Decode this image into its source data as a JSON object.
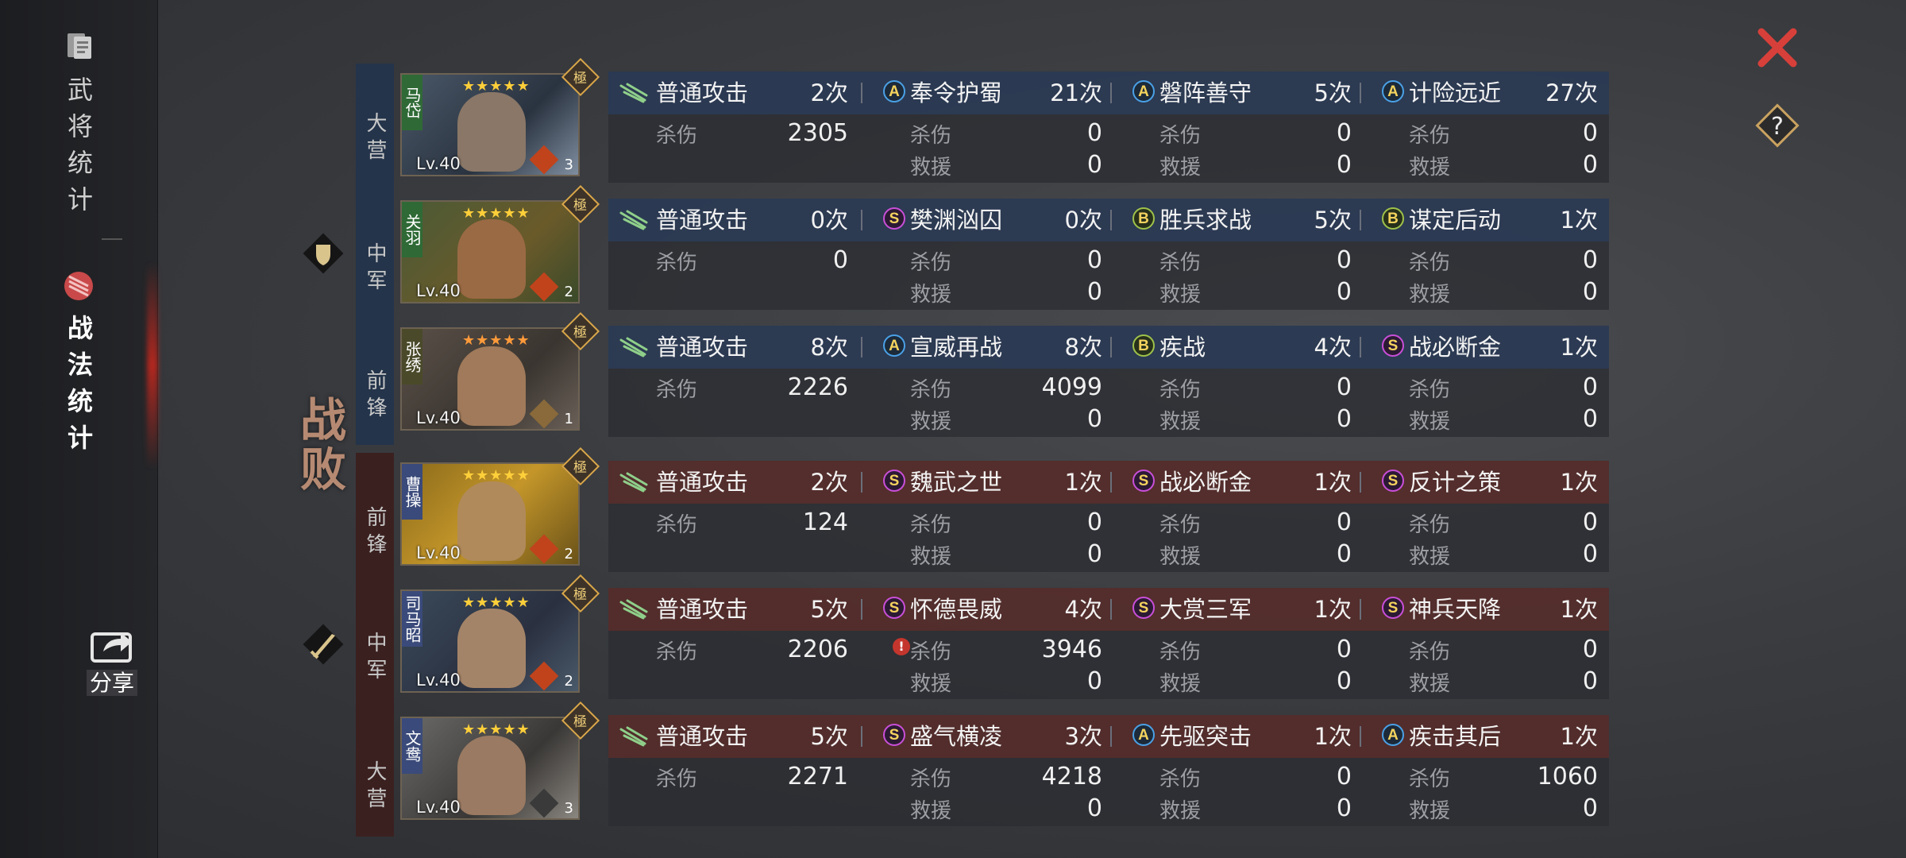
{
  "sidebar": {
    "stats_label": "武将统计",
    "tactic_label": "战法统计",
    "share_label": "分享"
  },
  "result_label": "战败",
  "header_buttons": {
    "close": "close",
    "help": "?"
  },
  "teams": [
    {
      "side": "ally",
      "color": "#24344a",
      "generals": [
        {
          "position": "大营",
          "name": "马岱",
          "level": "Lv.40",
          "stars": 5,
          "rank": "極",
          "copies": "3",
          "skills": [
            {
              "grade": "",
              "name": "普通攻击",
              "count": "2次",
              "kill_label": "杀伤",
              "kill": "2305",
              "heal_label": "",
              "heal": ""
            },
            {
              "grade": "A",
              "name": "奉令护蜀",
              "count": "21次",
              "kill_label": "杀伤",
              "kill": "0",
              "heal_label": "救援",
              "heal": "0"
            },
            {
              "grade": "A",
              "name": "磐阵善守",
              "count": "5次",
              "kill_label": "杀伤",
              "kill": "0",
              "heal_label": "救援",
              "heal": "0"
            },
            {
              "grade": "A",
              "name": "计险远近",
              "count": "27次",
              "kill_label": "杀伤",
              "kill": "0",
              "heal_label": "救援",
              "heal": "0"
            }
          ]
        },
        {
          "position": "中军",
          "name": "关羽",
          "level": "Lv.40",
          "stars": 5,
          "rank": "極",
          "copies": "2",
          "skills": [
            {
              "grade": "",
              "name": "普通攻击",
              "count": "0次",
              "kill_label": "杀伤",
              "kill": "0",
              "heal_label": "",
              "heal": ""
            },
            {
              "grade": "S",
              "name": "樊渊汹囚",
              "count": "0次",
              "kill_label": "杀伤",
              "kill": "0",
              "heal_label": "救援",
              "heal": "0"
            },
            {
              "grade": "B",
              "name": "胜兵求战",
              "count": "5次",
              "kill_label": "杀伤",
              "kill": "0",
              "heal_label": "救援",
              "heal": "0"
            },
            {
              "grade": "B",
              "name": "谋定后动",
              "count": "1次",
              "kill_label": "杀伤",
              "kill": "0",
              "heal_label": "救援",
              "heal": "0"
            }
          ]
        },
        {
          "position": "前锋",
          "name": "张绣",
          "level": "Lv.40",
          "stars": 5,
          "rank": "極",
          "copies": "1",
          "skills": [
            {
              "grade": "",
              "name": "普通攻击",
              "count": "8次",
              "kill_label": "杀伤",
              "kill": "2226",
              "heal_label": "",
              "heal": ""
            },
            {
              "grade": "A",
              "name": "宣威再战",
              "count": "8次",
              "kill_label": "杀伤",
              "kill": "4099",
              "heal_label": "救援",
              "heal": "0"
            },
            {
              "grade": "B",
              "name": "疾战",
              "count": "4次",
              "kill_label": "杀伤",
              "kill": "0",
              "heal_label": "救援",
              "heal": "0"
            },
            {
              "grade": "S",
              "name": "战必断金",
              "count": "1次",
              "kill_label": "杀伤",
              "kill": "0",
              "heal_label": "救援",
              "heal": "0"
            }
          ]
        }
      ]
    },
    {
      "side": "enemy",
      "color": "#3b2020",
      "generals": [
        {
          "position": "前锋",
          "name": "曹操",
          "level": "Lv.40",
          "stars": 5,
          "rank": "極",
          "copies": "2",
          "skills": [
            {
              "grade": "",
              "name": "普通攻击",
              "count": "2次",
              "kill_label": "杀伤",
              "kill": "124",
              "heal_label": "",
              "heal": ""
            },
            {
              "grade": "S",
              "name": "魏武之世",
              "count": "1次",
              "kill_label": "杀伤",
              "kill": "0",
              "heal_label": "救援",
              "heal": "0"
            },
            {
              "grade": "S",
              "name": "战必断金",
              "count": "1次",
              "kill_label": "杀伤",
              "kill": "0",
              "heal_label": "救援",
              "heal": "0"
            },
            {
              "grade": "S",
              "name": "反计之策",
              "count": "1次",
              "kill_label": "杀伤",
              "kill": "0",
              "heal_label": "救援",
              "heal": "0"
            }
          ]
        },
        {
          "position": "中军",
          "name": "司马昭",
          "level": "Lv.40",
          "stars": 5,
          "rank": "極",
          "copies": "2",
          "skills": [
            {
              "grade": "",
              "name": "普通攻击",
              "count": "5次",
              "kill_label": "杀伤",
              "kill": "2206",
              "heal_label": "",
              "heal": ""
            },
            {
              "grade": "S",
              "name": "怀德畏威",
              "count": "4次",
              "kill_label": "杀伤",
              "kill": "3946",
              "heal_label": "救援",
              "heal": "0",
              "warn": "!"
            },
            {
              "grade": "S",
              "name": "大赏三军",
              "count": "1次",
              "kill_label": "杀伤",
              "kill": "0",
              "heal_label": "救援",
              "heal": "0"
            },
            {
              "grade": "S",
              "name": "神兵天降",
              "count": "1次",
              "kill_label": "杀伤",
              "kill": "0",
              "heal_label": "救援",
              "heal": "0"
            }
          ]
        },
        {
          "position": "大营",
          "name": "文鸯",
          "level": "Lv.40",
          "stars": 5,
          "rank": "極",
          "copies": "3",
          "skills": [
            {
              "grade": "",
              "name": "普通攻击",
              "count": "5次",
              "kill_label": "杀伤",
              "kill": "2271",
              "heal_label": "",
              "heal": ""
            },
            {
              "grade": "S",
              "name": "盛气横凌",
              "count": "3次",
              "kill_label": "杀伤",
              "kill": "4218",
              "heal_label": "救援",
              "heal": "0"
            },
            {
              "grade": "A",
              "name": "先驱突击",
              "count": "1次",
              "kill_label": "杀伤",
              "kill": "0",
              "heal_label": "救援",
              "heal": "0"
            },
            {
              "grade": "A",
              "name": "疾击其后",
              "count": "1次",
              "kill_label": "杀伤",
              "kill": "1060",
              "heal_label": "救援",
              "heal": "0"
            }
          ]
        }
      ]
    }
  ]
}
